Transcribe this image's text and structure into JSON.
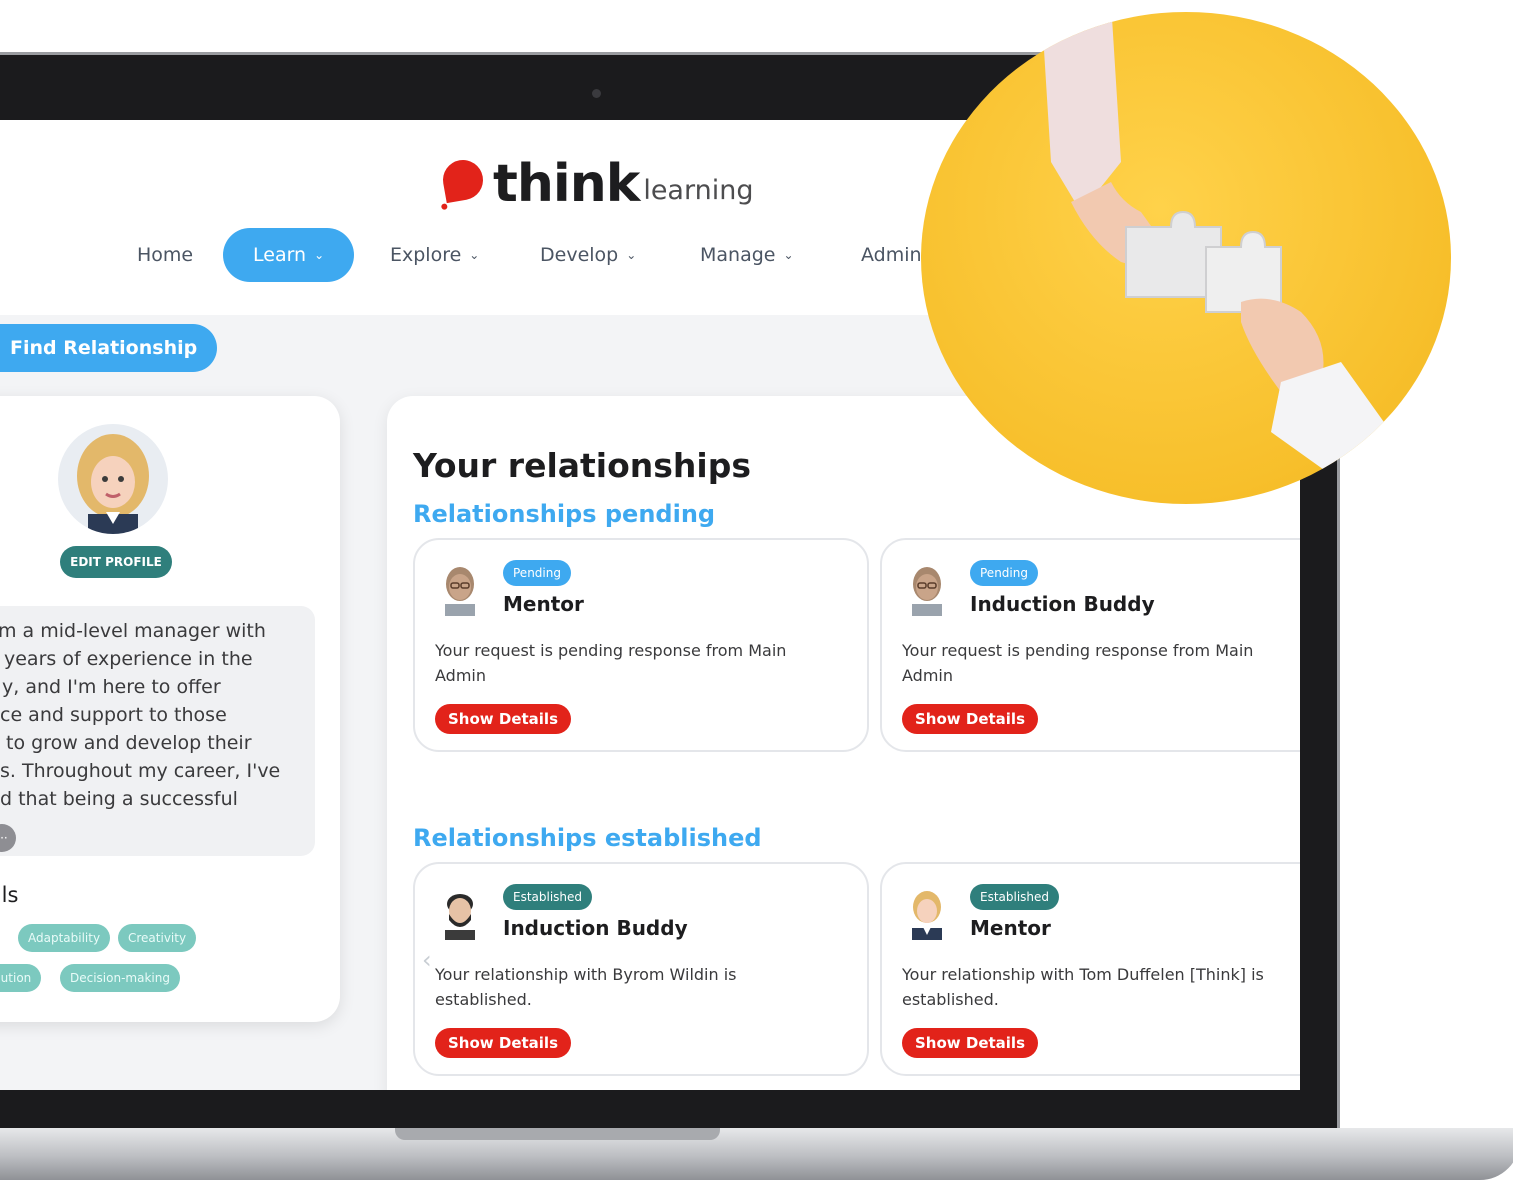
{
  "logo": {
    "think": "think",
    "learning": "learning"
  },
  "nav": {
    "items": [
      {
        "label": "Home",
        "chevron": ""
      },
      {
        "label": "Learn",
        "chevron": "⌄"
      },
      {
        "label": "Explore",
        "chevron": "⌄"
      },
      {
        "label": "Develop",
        "chevron": "⌄"
      },
      {
        "label": "Manage",
        "chevron": "⌄"
      },
      {
        "label": "Admin",
        "chevron": ""
      }
    ]
  },
  "find_relationship": "Find Relationship",
  "profile": {
    "edit_label": "EDIT PROFILE",
    "bio_lines": [
      "m a mid-level manager with",
      "years of experience in the",
      "y, and I'm here to offer",
      "ce and support to those",
      "to grow and develop their",
      "s. Throughout my career, I've",
      "d that being a successful"
    ],
    "more_label": "···",
    "skills_title": "ills",
    "skills": [
      "Adaptability",
      "Creativity",
      "olution",
      "Decision-making"
    ]
  },
  "relationships": {
    "title": "Your relationships",
    "pending_title": "Relationships pending",
    "established_title": "Relationships established",
    "show_details": "Show Details",
    "pending": [
      {
        "badge": "Pending",
        "role": "Mentor",
        "text": "Your request is pending response from Main Admin"
      },
      {
        "badge": "Pending",
        "role": "Induction Buddy",
        "text": "Your request is pending response from Main Admin"
      }
    ],
    "established": [
      {
        "badge": "Established",
        "role": "Induction Buddy",
        "text": "Your relationship with Byrom Wildin is established."
      },
      {
        "badge": "Established",
        "role": "Mentor",
        "text": "Your relationship with Tom Duffelen [Think] is established."
      }
    ]
  },
  "colors": {
    "accent_blue": "#3ea9f0",
    "brand_red": "#e2231a",
    "teal": "#2f7f7c",
    "circle_yellow": "#f7bf2b"
  }
}
